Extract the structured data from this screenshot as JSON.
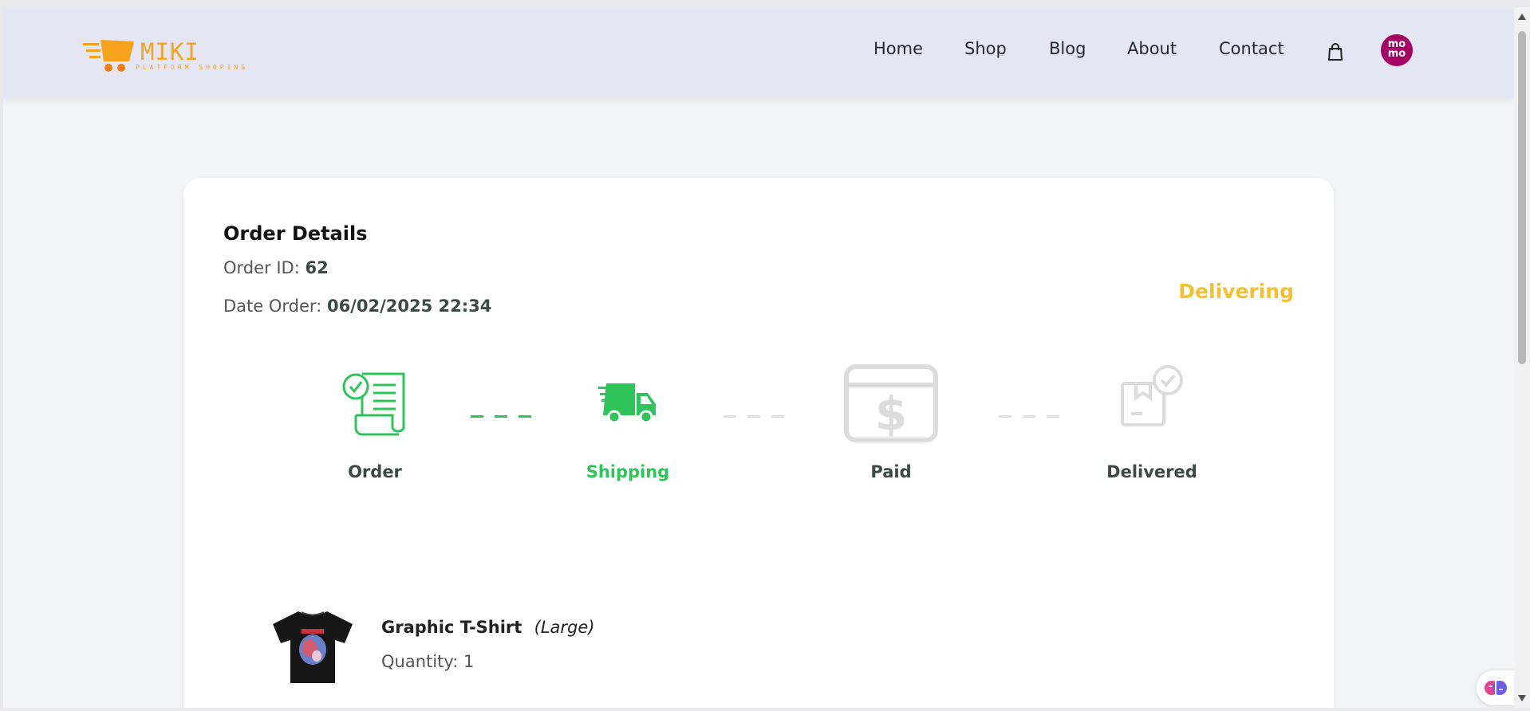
{
  "brand": {
    "name": "MIKI",
    "tagline": "PLATFORM SHOPING"
  },
  "nav": {
    "links": [
      {
        "label": "Home"
      },
      {
        "label": "Shop"
      },
      {
        "label": "Blog"
      },
      {
        "label": "About"
      },
      {
        "label": "Contact"
      }
    ],
    "cart_icon": "shopping-bag-icon",
    "payment_badge": {
      "line1": "mo",
      "line2": "mo"
    }
  },
  "order": {
    "title": "Order Details",
    "id_label": "Order ID:",
    "id_value": "62",
    "date_label": "Date Order:",
    "date_value": "06/02/2025 22:34",
    "status": "Delivering",
    "steps": [
      {
        "label": "Order",
        "icon": "receipt-check-icon",
        "active": true
      },
      {
        "label": "Shipping",
        "icon": "delivery-truck-icon",
        "active": true
      },
      {
        "label": "Paid",
        "icon": "dollar-card-icon",
        "active": false
      },
      {
        "label": "Delivered",
        "icon": "package-check-icon",
        "active": false
      }
    ],
    "item": {
      "name": "Graphic T-Shirt",
      "size": "(Large)",
      "quantity": "Quantity: 1",
      "image_icon": "tshirt-image"
    }
  },
  "colors": {
    "accent_green": "#2fc45a",
    "inactive_gray": "#d9d9d9",
    "status_yellow": "#f2c12e",
    "brand_orange": "#f7a21b",
    "momo_pink": "#a50064",
    "nav_bg": "#e4e7f3"
  }
}
